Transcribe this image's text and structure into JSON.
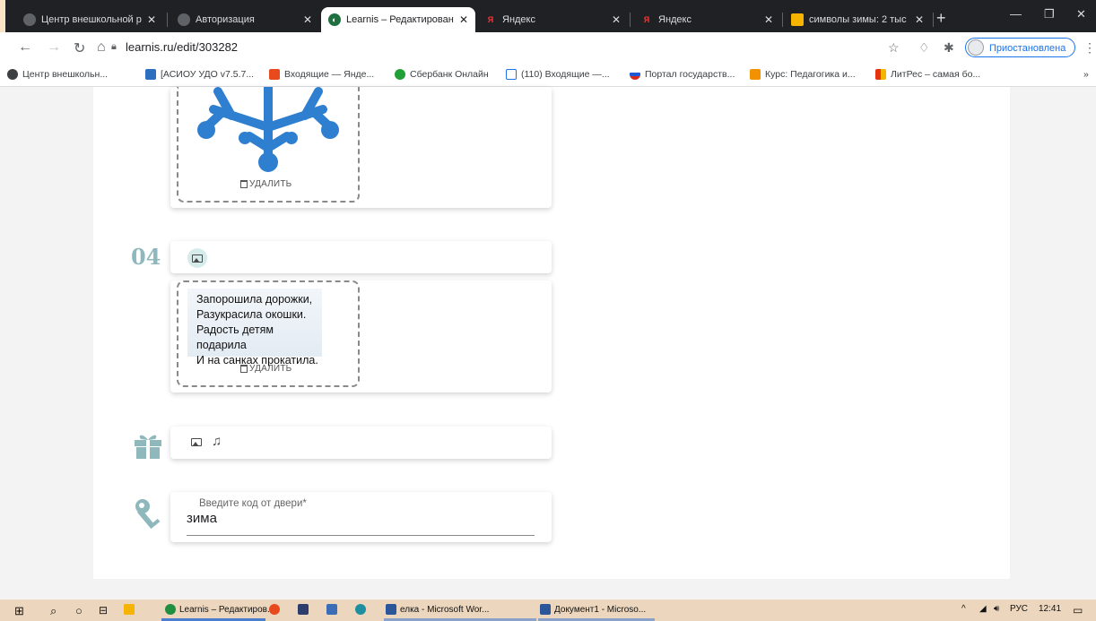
{
  "browser": {
    "tabs": [
      {
        "title": "Центр внешкольной р",
        "active": false
      },
      {
        "title": "Авторизация",
        "active": false
      },
      {
        "title": "Learnis – Редактирован",
        "active": true
      },
      {
        "title": "Яндекс",
        "active": false
      },
      {
        "title": "Яндекс",
        "active": false
      },
      {
        "title": "символы зимы: 2 тыс",
        "active": false
      }
    ],
    "url": "learnis.ru/edit/303282",
    "profile_label": "Приостановлена",
    "bookmarks": [
      "Центр внешкольн...",
      "[АСИОУ УДО v7.5.7...",
      "Входящие — Янде...",
      "Сбербанк Онлайн",
      "(110) Входящие —...",
      "Портал государств...",
      "Курс: Педагогика и...",
      "ЛитРес – самая бо..."
    ],
    "bookmarks_more": "»"
  },
  "page": {
    "delete_label_1": "УДАЛИТЬ",
    "step_number": "04",
    "poem_lines": [
      "Запорошила дорожки,",
      "Разукрасила окошки.",
      "Радость детям подарила",
      "И на санках прокатила."
    ],
    "delete_label_2": "УДАЛИТЬ",
    "door_code": {
      "label": "Введите код от двери*",
      "value": "зима"
    }
  },
  "taskbar": {
    "items": [
      "Learnis – Редактиров...",
      "елка - Microsoft Wor...",
      "Документ1 - Microso..."
    ],
    "language": "РУС",
    "time": "12:41"
  },
  "colors": {
    "snowflake": "#2f7fd1",
    "accent_teal": "#8fb8bd",
    "profile_blue": "#1a73e8"
  }
}
